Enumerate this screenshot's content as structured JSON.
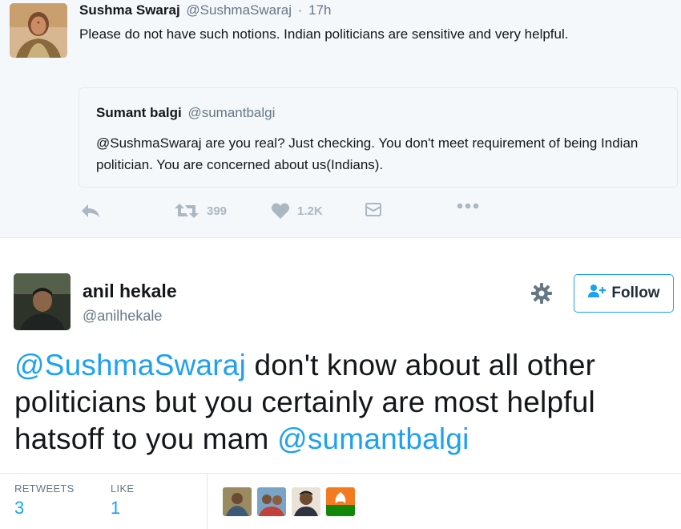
{
  "quoted_tweet_by": {
    "name": "Sushma Swaraj",
    "handle": "@SushmaSwaraj",
    "separator": "·",
    "time": "17h",
    "text": "Please do not have such notions. Indian politicians are sensitive and very helpful."
  },
  "embedded_quote": {
    "name": "Sumant balgi",
    "handle": "@sumantbalgi",
    "text": "@SushmaSwaraj are you real? Just checking. You don't meet requirement of being Indian politician. You are concerned about us(Indians)."
  },
  "actions": {
    "reply_icon": "reply-icon",
    "retweet_icon": "retweet-icon",
    "retweet_count": "399",
    "like_icon": "heart-icon",
    "like_count": "1.2K",
    "dm_icon": "direct-message-icon",
    "more_icon": "more-dots-icon"
  },
  "main_tweet": {
    "name": "anil hekale",
    "handle": "@anilhekale",
    "follow_label": "Follow",
    "gear_icon": "gear-icon",
    "text_mention_1": "@SushmaSwaraj",
    "text_body": " don't know about all other politicians but you certainly are most helpful hatsoff to you mam ",
    "text_mention_2": "@sumantbalgi"
  },
  "stats": {
    "retweets_label": "RETWEETS",
    "retweets_value": "3",
    "likes_label": "LIKE",
    "likes_value": "1"
  },
  "colors": {
    "brand_blue": "#1da1f2",
    "muted_text": "#657786",
    "icon_grey": "#aab8c2",
    "grey_bg": "#f5f8fa"
  }
}
